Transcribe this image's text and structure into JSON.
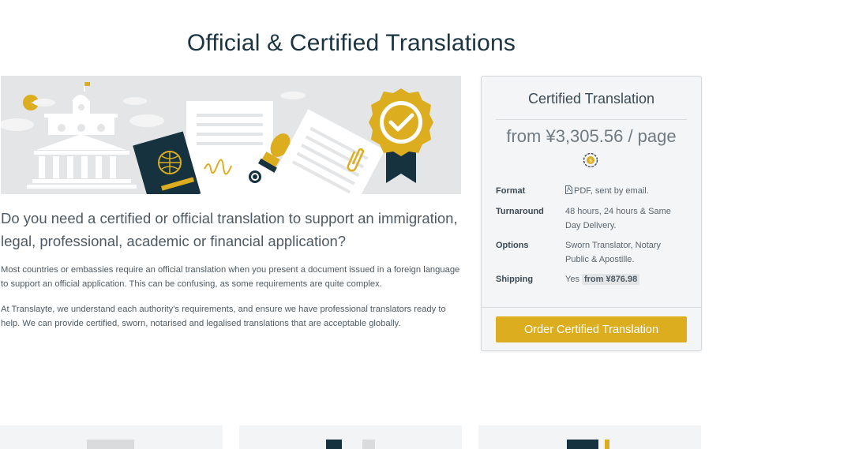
{
  "page": {
    "title": "Official & Certified Translations"
  },
  "intro": {
    "lead": "Do you need a certified or official translation to support an immigration, legal, professional, academic or financial application?",
    "paragraph_1": "Most countries or embassies require an official translation when you present a document issued in a foreign language to support an official application. This can be confusing, as some requirements are quite complex.",
    "paragraph_2": "At Translayte, we understand each authority's requirements, and ensure we have professional translators ready to help. We can provide certified, sworn, notarised and legalised translations that are acceptable globally."
  },
  "card": {
    "title": "Certified Translation",
    "price": "from ¥3,305.56 / page",
    "currency_icon": "coin-currency-icon",
    "specs": [
      {
        "key": "Format",
        "value": "PDF, sent by email."
      },
      {
        "key": "Turnaround",
        "value": "48 hours, 24 hours & Same Day Delivery."
      },
      {
        "key": "Options",
        "value": "Sworn Translator, Notary Public & Apostille."
      },
      {
        "key": "Shipping",
        "value": "Yes",
        "badge": "from ¥876.98"
      }
    ],
    "button_label": "Order Certified Translation"
  },
  "colors": {
    "accent": "#dcad1e",
    "heading": "#1a3441",
    "navy": "#16323f"
  },
  "hero_icons": [
    "government-building-icon",
    "passport-icon",
    "stamp-icon",
    "document-icon",
    "paperclip-icon",
    "certified-badge-icon",
    "sun-icon",
    "cloud-icon"
  ]
}
